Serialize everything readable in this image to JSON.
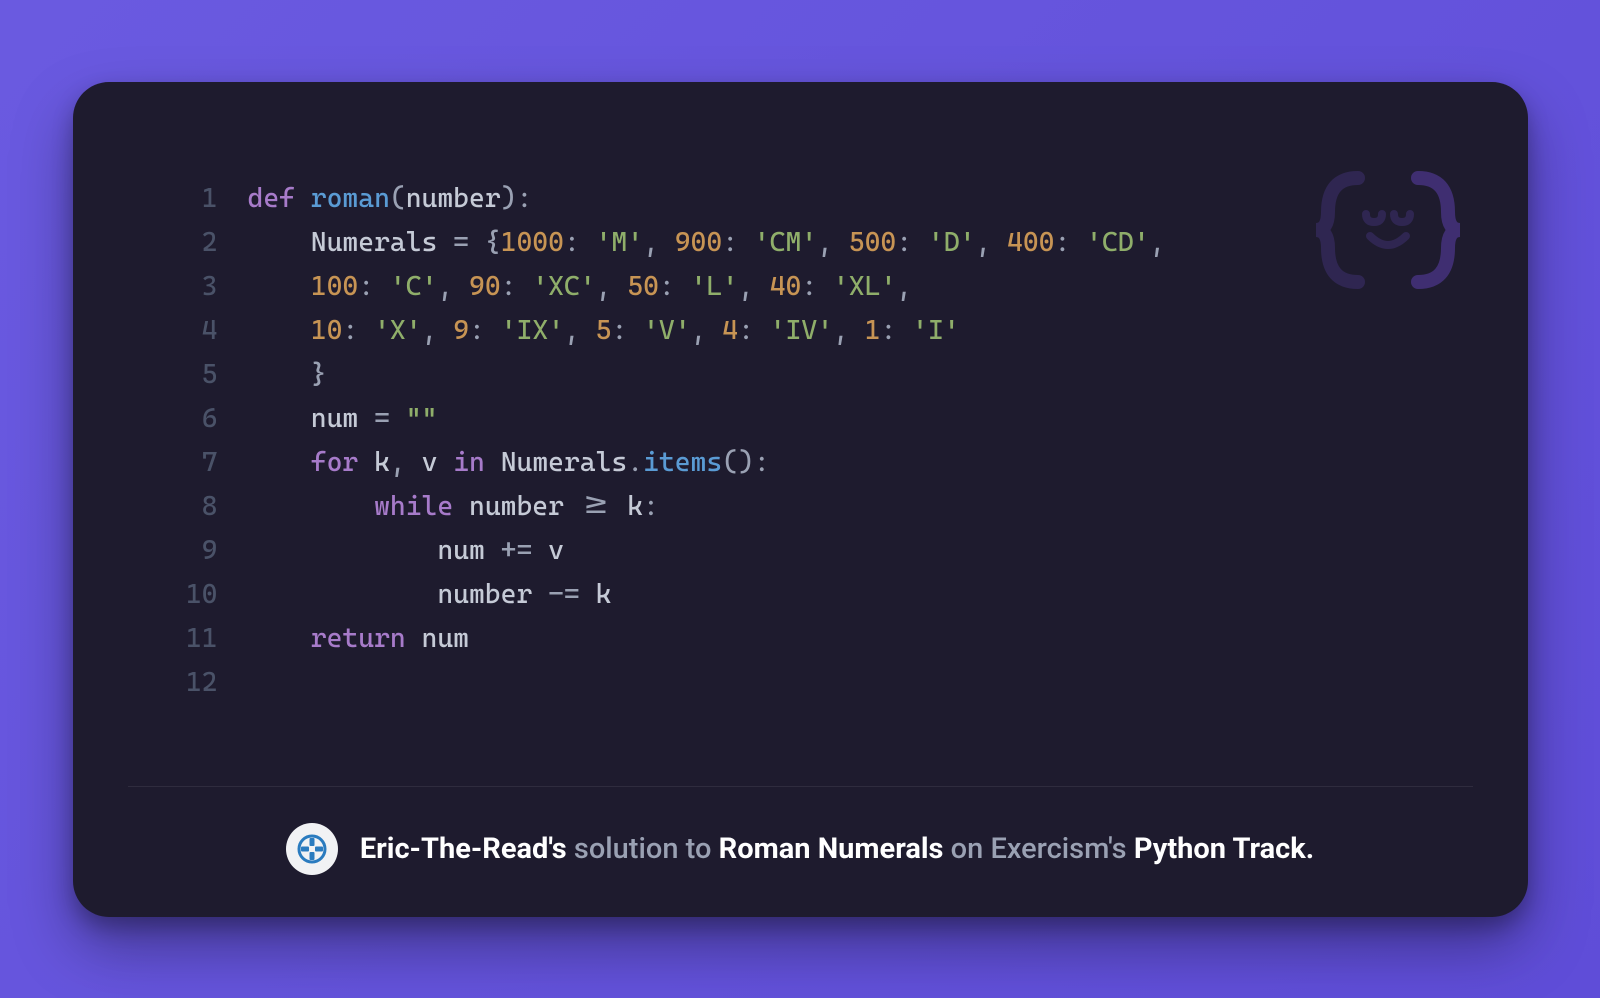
{
  "code": {
    "lines": [
      {
        "n": "1",
        "tokens": [
          [
            "kw",
            "def "
          ],
          [
            "fn",
            "roman"
          ],
          [
            "pun",
            "("
          ],
          [
            "prm",
            "number"
          ],
          [
            "pun",
            "):"
          ]
        ]
      },
      {
        "n": "2",
        "tokens": [
          [
            "code",
            "    "
          ],
          [
            "prm",
            "Numerals"
          ],
          [
            "code",
            " "
          ],
          [
            "op",
            "="
          ],
          [
            "code",
            " "
          ],
          [
            "pun",
            "{"
          ],
          [
            "num",
            "1000"
          ],
          [
            "pun",
            ":"
          ],
          [
            "code",
            " "
          ],
          [
            "str",
            "'M'"
          ],
          [
            "pun",
            ","
          ],
          [
            "code",
            " "
          ],
          [
            "num",
            "900"
          ],
          [
            "pun",
            ":"
          ],
          [
            "code",
            " "
          ],
          [
            "str",
            "'CM'"
          ],
          [
            "pun",
            ","
          ],
          [
            "code",
            " "
          ],
          [
            "num",
            "500"
          ],
          [
            "pun",
            ":"
          ],
          [
            "code",
            " "
          ],
          [
            "str",
            "'D'"
          ],
          [
            "pun",
            ","
          ],
          [
            "code",
            " "
          ],
          [
            "num",
            "400"
          ],
          [
            "pun",
            ":"
          ],
          [
            "code",
            " "
          ],
          [
            "str",
            "'CD'"
          ],
          [
            "pun",
            ","
          ]
        ]
      },
      {
        "n": "3",
        "tokens": [
          [
            "code",
            "    "
          ],
          [
            "num",
            "100"
          ],
          [
            "pun",
            ":"
          ],
          [
            "code",
            " "
          ],
          [
            "str",
            "'C'"
          ],
          [
            "pun",
            ","
          ],
          [
            "code",
            " "
          ],
          [
            "num",
            "90"
          ],
          [
            "pun",
            ":"
          ],
          [
            "code",
            " "
          ],
          [
            "str",
            "'XC'"
          ],
          [
            "pun",
            ","
          ],
          [
            "code",
            " "
          ],
          [
            "num",
            "50"
          ],
          [
            "pun",
            ":"
          ],
          [
            "code",
            " "
          ],
          [
            "str",
            "'L'"
          ],
          [
            "pun",
            ","
          ],
          [
            "code",
            " "
          ],
          [
            "num",
            "40"
          ],
          [
            "pun",
            ":"
          ],
          [
            "code",
            " "
          ],
          [
            "str",
            "'XL'"
          ],
          [
            "pun",
            ","
          ]
        ]
      },
      {
        "n": "4",
        "tokens": [
          [
            "code",
            "    "
          ],
          [
            "num",
            "10"
          ],
          [
            "pun",
            ":"
          ],
          [
            "code",
            " "
          ],
          [
            "str",
            "'X'"
          ],
          [
            "pun",
            ","
          ],
          [
            "code",
            " "
          ],
          [
            "num",
            "9"
          ],
          [
            "pun",
            ":"
          ],
          [
            "code",
            " "
          ],
          [
            "str",
            "'IX'"
          ],
          [
            "pun",
            ","
          ],
          [
            "code",
            " "
          ],
          [
            "num",
            "5"
          ],
          [
            "pun",
            ":"
          ],
          [
            "code",
            " "
          ],
          [
            "str",
            "'V'"
          ],
          [
            "pun",
            ","
          ],
          [
            "code",
            " "
          ],
          [
            "num",
            "4"
          ],
          [
            "pun",
            ":"
          ],
          [
            "code",
            " "
          ],
          [
            "str",
            "'IV'"
          ],
          [
            "pun",
            ","
          ],
          [
            "code",
            " "
          ],
          [
            "num",
            "1"
          ],
          [
            "pun",
            ":"
          ],
          [
            "code",
            " "
          ],
          [
            "str",
            "'I'"
          ]
        ]
      },
      {
        "n": "5",
        "tokens": [
          [
            "code",
            "    "
          ],
          [
            "pun",
            "}"
          ]
        ]
      },
      {
        "n": "6",
        "tokens": [
          [
            "code",
            "    "
          ],
          [
            "prm",
            "num"
          ],
          [
            "code",
            " "
          ],
          [
            "op",
            "="
          ],
          [
            "code",
            " "
          ],
          [
            "str",
            "\"\""
          ]
        ]
      },
      {
        "n": "7",
        "tokens": [
          [
            "code",
            "    "
          ],
          [
            "kw",
            "for"
          ],
          [
            "code",
            " "
          ],
          [
            "prm",
            "k"
          ],
          [
            "pun",
            ","
          ],
          [
            "code",
            " "
          ],
          [
            "prm",
            "v"
          ],
          [
            "code",
            " "
          ],
          [
            "kw",
            "in"
          ],
          [
            "code",
            " "
          ],
          [
            "prm",
            "Numerals"
          ],
          [
            "pun",
            "."
          ],
          [
            "fn",
            "items"
          ],
          [
            "pun",
            "():"
          ]
        ]
      },
      {
        "n": "8",
        "tokens": [
          [
            "code",
            "        "
          ],
          [
            "kw",
            "while"
          ],
          [
            "code",
            " "
          ],
          [
            "prm",
            "number"
          ],
          [
            "code",
            " "
          ],
          [
            "op",
            ">="
          ],
          [
            "code",
            " "
          ],
          [
            "prm",
            "k"
          ],
          [
            "pun",
            ":"
          ]
        ]
      },
      {
        "n": "9",
        "tokens": [
          [
            "code",
            "            "
          ],
          [
            "prm",
            "num"
          ],
          [
            "code",
            " "
          ],
          [
            "op",
            "+="
          ],
          [
            "code",
            " "
          ],
          [
            "prm",
            "v"
          ]
        ]
      },
      {
        "n": "10",
        "tokens": [
          [
            "code",
            "            "
          ],
          [
            "prm",
            "number"
          ],
          [
            "code",
            " "
          ],
          [
            "op",
            "-="
          ],
          [
            "code",
            " "
          ],
          [
            "prm",
            "k"
          ]
        ]
      },
      {
        "n": "11",
        "tokens": [
          [
            "code",
            "    "
          ],
          [
            "kw",
            "return"
          ],
          [
            "code",
            " "
          ],
          [
            "prm",
            "num"
          ]
        ]
      },
      {
        "n": "12",
        "tokens": []
      }
    ]
  },
  "footer": {
    "user": "Eric-The-Read's",
    "w1": " solution to ",
    "exercise": "Roman Numerals",
    "w2": " on Exercism's ",
    "track": "Python Track."
  },
  "logo": {
    "name": "exercism-logo"
  },
  "colors": {
    "bg_outer": "#6a5ae0",
    "bg_card": "#1e1b2e",
    "keyword": "#a77bca",
    "function": "#5a9bd4",
    "number": "#c79454",
    "string": "#8fae6a"
  }
}
